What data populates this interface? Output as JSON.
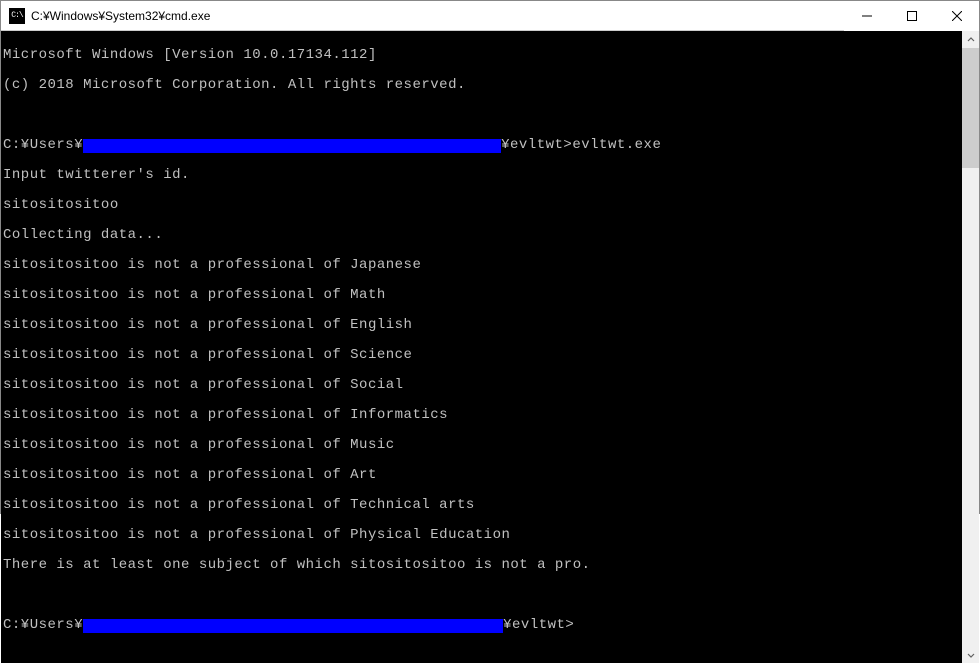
{
  "window": {
    "title": "C:¥Windows¥System32¥cmd.exe",
    "icon_label": "C:\\"
  },
  "terminal": {
    "header1": "Microsoft Windows [Version 10.0.17134.112]",
    "header2": "(c) 2018 Microsoft Corporation. All rights reserved.",
    "prompt1_prefix": "C:¥Users¥",
    "prompt1_suffix": "¥evltwt>evltwt.exe",
    "input_prompt": "Input twitterer's id.",
    "user_input": "sitositositoo",
    "collecting": "Collecting data...",
    "results": [
      "sitositositoo is not a professional of Japanese",
      "sitositositoo is not a professional of Math",
      "sitositositoo is not a professional of English",
      "sitositositoo is not a professional of Science",
      "sitositositoo is not a professional of Social",
      "sitositositoo is not a professional of Informatics",
      "sitositositoo is not a professional of Music",
      "sitositositoo is not a professional of Art",
      "sitositositoo is not a professional of Technical arts",
      "sitositositoo is not a professional of Physical Education"
    ],
    "summary": "There is at least one subject of which sitositositoo is not a pro.",
    "prompt2_prefix": "C:¥Users¥",
    "prompt2_suffix": "¥evltwt>"
  },
  "colors": {
    "terminal_bg": "#000000",
    "terminal_fg": "#c0c0c0",
    "redaction": "#0000ff",
    "titlebar_bg": "#ffffff"
  }
}
